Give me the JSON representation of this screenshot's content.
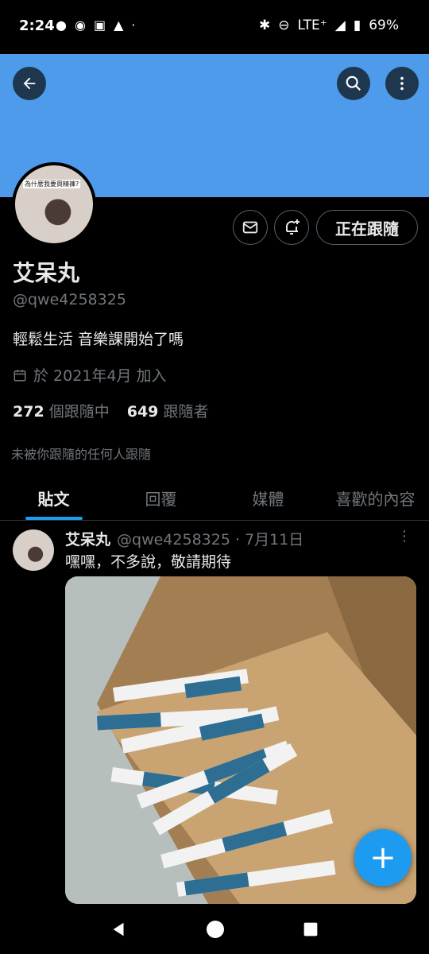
{
  "status_bar": {
    "time": "2:24",
    "network": "LTE⁺",
    "battery": "69%"
  },
  "header": {
    "back_icon": "back-arrow-icon",
    "search_icon": "search-icon",
    "more_icon": "more-vertical-icon",
    "banner_color": "#4d9bea"
  },
  "profile": {
    "avatar_caption": "為什麼我要買精褲?",
    "name": "艾呆丸",
    "handle": "@qwe4258325",
    "bio": "輕鬆生活 音樂課開始了嗎",
    "joined": "於 2021年4月 加入",
    "following_count": "272",
    "following_label": "個跟隨中",
    "followers_count": "649",
    "followers_label": "跟隨者",
    "not_followed_note": "未被你跟隨的任何人跟隨",
    "following_button": "正在跟隨"
  },
  "tabs": [
    {
      "label": "貼文",
      "active": true
    },
    {
      "label": "回覆",
      "active": false
    },
    {
      "label": "媒體",
      "active": false
    },
    {
      "label": "喜歡的內容",
      "active": false
    }
  ],
  "tweet": {
    "name": "艾呆丸",
    "meta": "@qwe4258325 · 7月11日",
    "text": "嘿嘿，不多說，敬請期待"
  },
  "fab": {
    "icon": "plus-icon",
    "label": "+"
  },
  "accent_color": "#1d9bf0"
}
